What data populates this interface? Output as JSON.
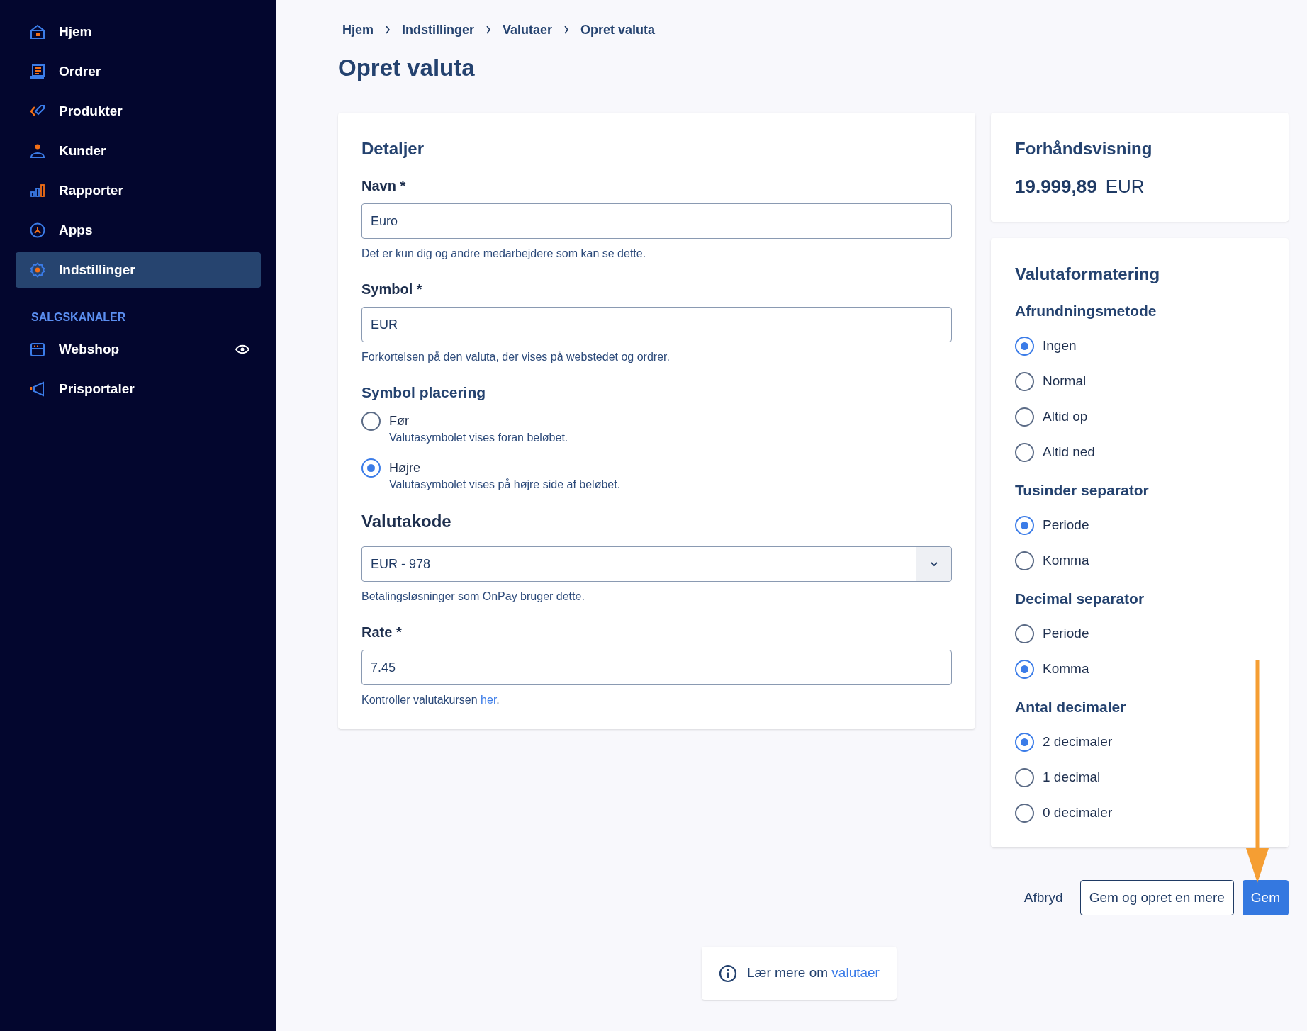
{
  "sidebar": {
    "items": [
      {
        "label": "Hjem",
        "selected": false
      },
      {
        "label": "Ordrer",
        "selected": false
      },
      {
        "label": "Produkter",
        "selected": false
      },
      {
        "label": "Kunder",
        "selected": false
      },
      {
        "label": "Rapporter",
        "selected": false
      },
      {
        "label": "Apps",
        "selected": false
      },
      {
        "label": "Indstillinger",
        "selected": true
      }
    ],
    "section_label": "SALGSKANALER",
    "channels": [
      {
        "label": "Webshop",
        "visible": true
      },
      {
        "label": "Prisportaler",
        "visible": false
      }
    ]
  },
  "breadcrumb": [
    {
      "label": "Hjem",
      "kind": "link"
    },
    {
      "label": "Indstillinger",
      "kind": "link"
    },
    {
      "label": "Valutaer",
      "kind": "link"
    },
    {
      "label": "Opret valuta",
      "kind": "current"
    }
  ],
  "page_title": "Opret valuta",
  "details": {
    "title": "Detaljer",
    "fields": [
      {
        "kind": "text",
        "label": "Navn *",
        "value": "Euro",
        "help": "Det er kun dig og andre medarbejdere som kan se dette."
      },
      {
        "kind": "text",
        "label": "Symbol *",
        "value": "EUR",
        "help": "Forkortelsen på den valuta, der vises på webstedet og ordrer."
      },
      {
        "kind": "radio",
        "label": "Symbol placering",
        "options": [
          {
            "label": "Før",
            "description": "Valutasymbolet vises foran beløbet.",
            "selected": false
          },
          {
            "label": "Højre",
            "description": "Valutasymbolet vises på højre side af beløbet.",
            "selected": true
          }
        ]
      },
      {
        "kind": "select",
        "label": "Valutakode",
        "value": "EUR - 978",
        "help": "Betalingsløsninger som OnPay bruger dette."
      },
      {
        "kind": "text",
        "label": "Rate *",
        "value": "7.45",
        "help": "Kontroller valutakursen ",
        "help_link": "her",
        "help_suffix": "."
      }
    ]
  },
  "preview": {
    "title": "Forhåndsvisning",
    "amount": "19.999,89",
    "symbol": "EUR"
  },
  "formatting": {
    "title": "Valutaformatering",
    "groups": [
      {
        "title": "Afrundningsmetode",
        "options": [
          {
            "label": "Ingen",
            "selected": true
          },
          {
            "label": "Normal",
            "selected": false
          },
          {
            "label": "Altid op",
            "selected": false
          },
          {
            "label": "Altid ned",
            "selected": false
          }
        ]
      },
      {
        "title": "Tusinder separator",
        "options": [
          {
            "label": "Periode",
            "selected": true
          },
          {
            "label": "Komma",
            "selected": false
          }
        ]
      },
      {
        "title": "Decimal separator",
        "options": [
          {
            "label": "Periode",
            "selected": false
          },
          {
            "label": "Komma",
            "selected": true
          }
        ]
      },
      {
        "title": "Antal decimaler",
        "options": [
          {
            "label": "2 decimaler",
            "selected": true
          },
          {
            "label": "1 decimal",
            "selected": false
          },
          {
            "label": "0 decimaler",
            "selected": false
          }
        ]
      }
    ]
  },
  "actions": [
    {
      "label": "Afbryd",
      "kind": "link"
    },
    {
      "label": "Gem og opret en mere",
      "kind": "secondary"
    },
    {
      "label": "Gem",
      "kind": "primary"
    }
  ],
  "info": {
    "text": "Lær mere om ",
    "link": "valutaer"
  }
}
